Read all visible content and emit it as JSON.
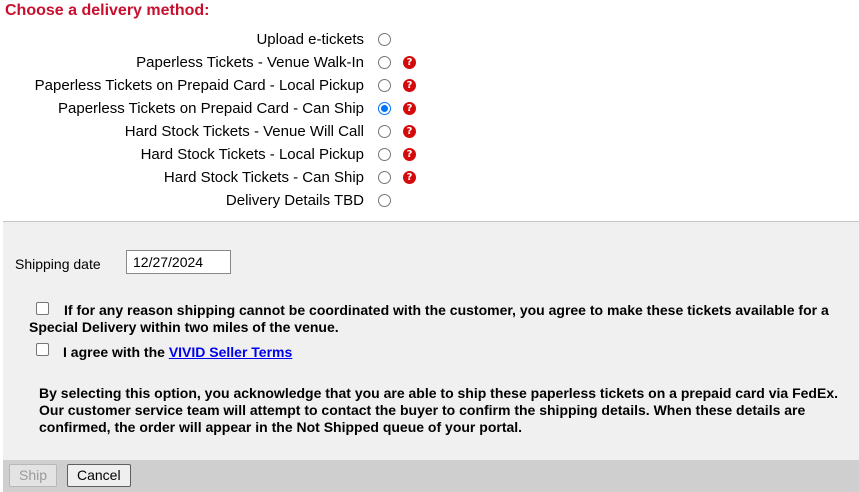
{
  "heading": "Choose a delivery method:",
  "delivery_methods": [
    {
      "label": "Upload e-tickets",
      "selected": false,
      "help": false
    },
    {
      "label": "Paperless Tickets - Venue Walk-In",
      "selected": false,
      "help": true
    },
    {
      "label": "Paperless Tickets on Prepaid Card - Local Pickup",
      "selected": false,
      "help": true
    },
    {
      "label": "Paperless Tickets on Prepaid Card - Can Ship",
      "selected": true,
      "help": true
    },
    {
      "label": "Hard Stock Tickets - Venue Will Call",
      "selected": false,
      "help": true
    },
    {
      "label": "Hard Stock Tickets - Local Pickup",
      "selected": false,
      "help": true
    },
    {
      "label": "Hard Stock Tickets - Can Ship",
      "selected": false,
      "help": true
    },
    {
      "label": "Delivery Details TBD",
      "selected": false,
      "help": false
    }
  ],
  "help_icon_glyph": "?",
  "shipping": {
    "label": "Shipping date",
    "date_value": "12/27/2024"
  },
  "special_delivery": {
    "checked": false,
    "text": "If for any reason shipping cannot be coordinated with the customer, you agree to make these tickets available for a Special Delivery within two miles of the venue."
  },
  "terms": {
    "checked": false,
    "prefix": "I agree with the ",
    "link_text": "VIVID Seller Terms"
  },
  "acknowledgement": "By selecting this option, you acknowledge that you are able to ship these paperless tickets on a prepaid card via FedEx. Our customer service team will attempt to contact the buyer to confirm the shipping details. When these details are confirmed, the order will appear in the Not Shipped queue of your portal.",
  "buttons": {
    "ship": "Ship",
    "cancel": "Cancel"
  },
  "colors": {
    "heading": "#c8102e",
    "radio_selected": "#0075ff",
    "help_icon": "#d40a0a",
    "link": "#0000ee"
  }
}
